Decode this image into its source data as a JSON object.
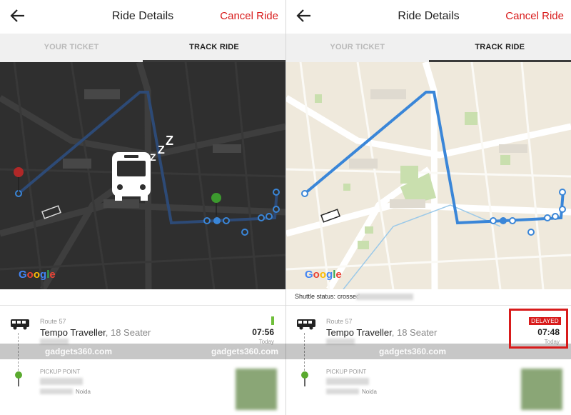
{
  "left": {
    "header": {
      "title": "Ride Details",
      "cancel_label": "Cancel Ride"
    },
    "tabs": [
      {
        "label": "YOUR TICKET"
      },
      {
        "label": "TRACK RIDE"
      }
    ],
    "map": {
      "theme": "dark",
      "attribution": "Google",
      "sleep_text": "ZZZ"
    },
    "ride": {
      "route": "Route 57",
      "vehicle": "Tempo Traveller",
      "seats": ", 18 Seater",
      "time": "07:56",
      "day": "Today"
    },
    "pickup": {
      "label": "PICKUP POINT",
      "city": "Noida"
    },
    "watermarks": [
      "gadgets360.com",
      "gadgets360.com"
    ]
  },
  "right": {
    "header": {
      "title": "Ride Details",
      "cancel_label": "Cancel Ride"
    },
    "tabs": [
      {
        "label": "YOUR TICKET"
      },
      {
        "label": "TRACK RIDE"
      }
    ],
    "map": {
      "theme": "light",
      "attribution": "Google"
    },
    "status_text": "Shuttle status: crossed",
    "ride": {
      "route": "Route 57",
      "vehicle": "Tempo Traveller",
      "seats": ", 18 Seater",
      "badge": "DELAYED",
      "time": "07:48",
      "day": "Today"
    },
    "pickup": {
      "label": "PICKUP POINT",
      "city": "Noida"
    },
    "watermarks": [
      "gadgets360.com"
    ]
  },
  "colors": {
    "accent_red": "#d81b1b",
    "route_blue": "#3a86d8",
    "route_dark": "#2d4a76",
    "active_tab": "#222222",
    "inactive_tab": "#b9b9b9"
  }
}
